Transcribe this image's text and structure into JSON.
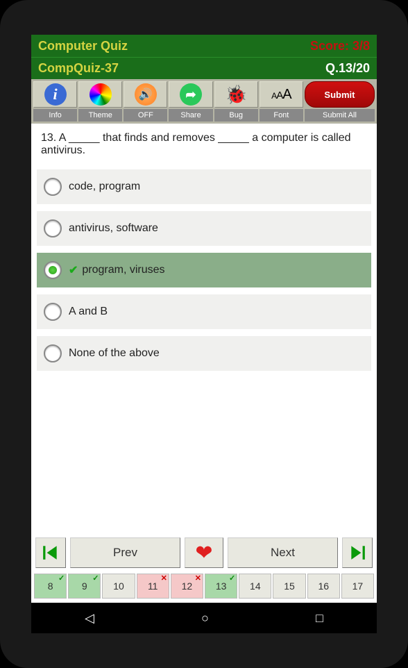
{
  "header": {
    "appTitle": "Computer Quiz",
    "score": "Score: 3/8",
    "quizName": "CompQuiz-37",
    "qCounter": "Q.13/20"
  },
  "toolbar": {
    "info": "Info",
    "theme": "Theme",
    "sound": "OFF",
    "share": "Share",
    "bug": "Bug",
    "font": "Font",
    "submit": "Submit",
    "submitAll": "Submit All"
  },
  "question": {
    "text": "13. A _____ that finds and removes _____ a computer is called antivirus.",
    "options": [
      {
        "label": "code, program",
        "selected": false,
        "correct": false
      },
      {
        "label": "antivirus, software",
        "selected": false,
        "correct": false
      },
      {
        "label": "program, viruses",
        "selected": true,
        "correct": true
      },
      {
        "label": "A and B",
        "selected": false,
        "correct": false
      },
      {
        "label": "None of the above",
        "selected": false,
        "correct": false
      }
    ]
  },
  "nav": {
    "prev": "Prev",
    "next": "Next"
  },
  "qgrid": [
    {
      "n": "8",
      "state": "correct"
    },
    {
      "n": "9",
      "state": "correct"
    },
    {
      "n": "10",
      "state": "none"
    },
    {
      "n": "11",
      "state": "wrong"
    },
    {
      "n": "12",
      "state": "wrong"
    },
    {
      "n": "13",
      "state": "correct"
    },
    {
      "n": "14",
      "state": "none"
    },
    {
      "n": "15",
      "state": "none"
    },
    {
      "n": "16",
      "state": "none"
    },
    {
      "n": "17",
      "state": "none"
    }
  ]
}
